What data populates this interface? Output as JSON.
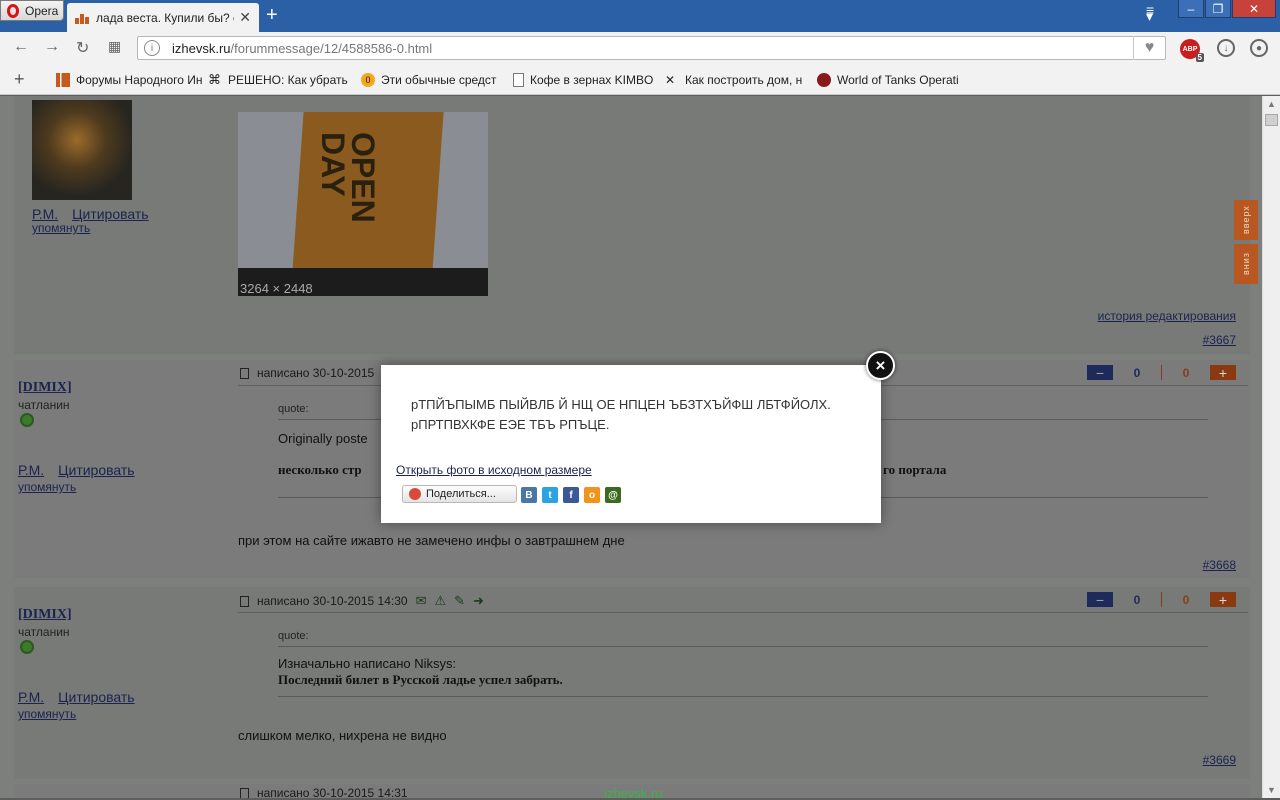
{
  "browser": {
    "app_name": "Opera",
    "tab_title": "лада веста. Купили бы? стр",
    "url_host": "izhevsk.ru",
    "url_path": "/forummessage/12/4588586-0.html",
    "adblock_count": "5",
    "adblock_label": "ABP"
  },
  "bookmarks": [
    {
      "label": "Форумы Народного Ин",
      "icon": "izhevsk-icon"
    },
    {
      "label": "РЕШЕНО: Как убрать",
      "icon": "puzzle-icon"
    },
    {
      "label": "Эти обычные средст",
      "icon": "coin-icon"
    },
    {
      "label": "Кофе в зернах KIMBO",
      "icon": "page-icon"
    },
    {
      "label": "Как построить дом, н",
      "icon": "tools-icon"
    },
    {
      "label": "World of Tanks Operati",
      "icon": "wot-icon"
    }
  ],
  "posts": [
    {
      "user_links": {
        "pm": "Р.М.",
        "quote": "Цитировать",
        "mention": "упомянуть"
      },
      "photo_dims": "3264 × 2448",
      "photo_text": "OPEN DAY",
      "history_link": "история редактирования",
      "number": "#3667"
    },
    {
      "username": "[DIMIX]",
      "rank": "чатланин",
      "meta": "написано 30-10-2015",
      "votes_minus": "0",
      "votes_plus": "0",
      "quote_label": "quote:",
      "quote_author": "Originally poste",
      "quote_body_start": "несколько стр",
      "quote_body_end": "го портала",
      "text": "при этом на сайте ижавто не замечено инфы о завтрашнем дне",
      "user_links": {
        "pm": "Р.М.",
        "quote": "Цитировать",
        "mention": "упомянуть"
      },
      "number": "#3668"
    },
    {
      "username": "[DIMIX]",
      "rank": "чатланин",
      "meta": "написано 30-10-2015 14:30",
      "votes_minus": "0",
      "votes_plus": "0",
      "quote_label": "quote:",
      "quote_author": "Изначально написано Niksys:",
      "quote_body": "Последний билет в Русской ладье успел забрать.",
      "text": "слишком мелко, нихрена не видно",
      "user_links": {
        "pm": "Р.М.",
        "quote": "Цитировать",
        "mention": "упомянуть"
      },
      "number": "#3669"
    },
    {
      "meta": "написано 30-10-2015 14:31"
    }
  ],
  "scroll_nav": {
    "up": "вверх",
    "down": "вниз"
  },
  "footer_site": "izhevsk.ru",
  "modal": {
    "message": "рТПЙЪПЫМБ ПЫЙВЛБ Й НЩ ОЕ НПЦЕН ЪБЗТХЪЙФШ ЛБТФЙОЛХ. рПРТПВХКФЕ ЕЭЕ ТБЪ РПЪЦЕ.",
    "open_link": "Открыть фото в исходном размере",
    "share_label": "Поделиться...",
    "social": [
      {
        "label": "В",
        "color": "#4a76a8",
        "icon": "vk-icon"
      },
      {
        "label": "t",
        "color": "#2aa3e0",
        "icon": "twitter-icon"
      },
      {
        "label": "f",
        "color": "#3b5998",
        "icon": "facebook-icon"
      },
      {
        "label": "о",
        "color": "#f2931e",
        "icon": "odnoklassniki-icon"
      },
      {
        "label": "@",
        "color": "#3a6b1e",
        "icon": "mailru-icon"
      }
    ]
  }
}
